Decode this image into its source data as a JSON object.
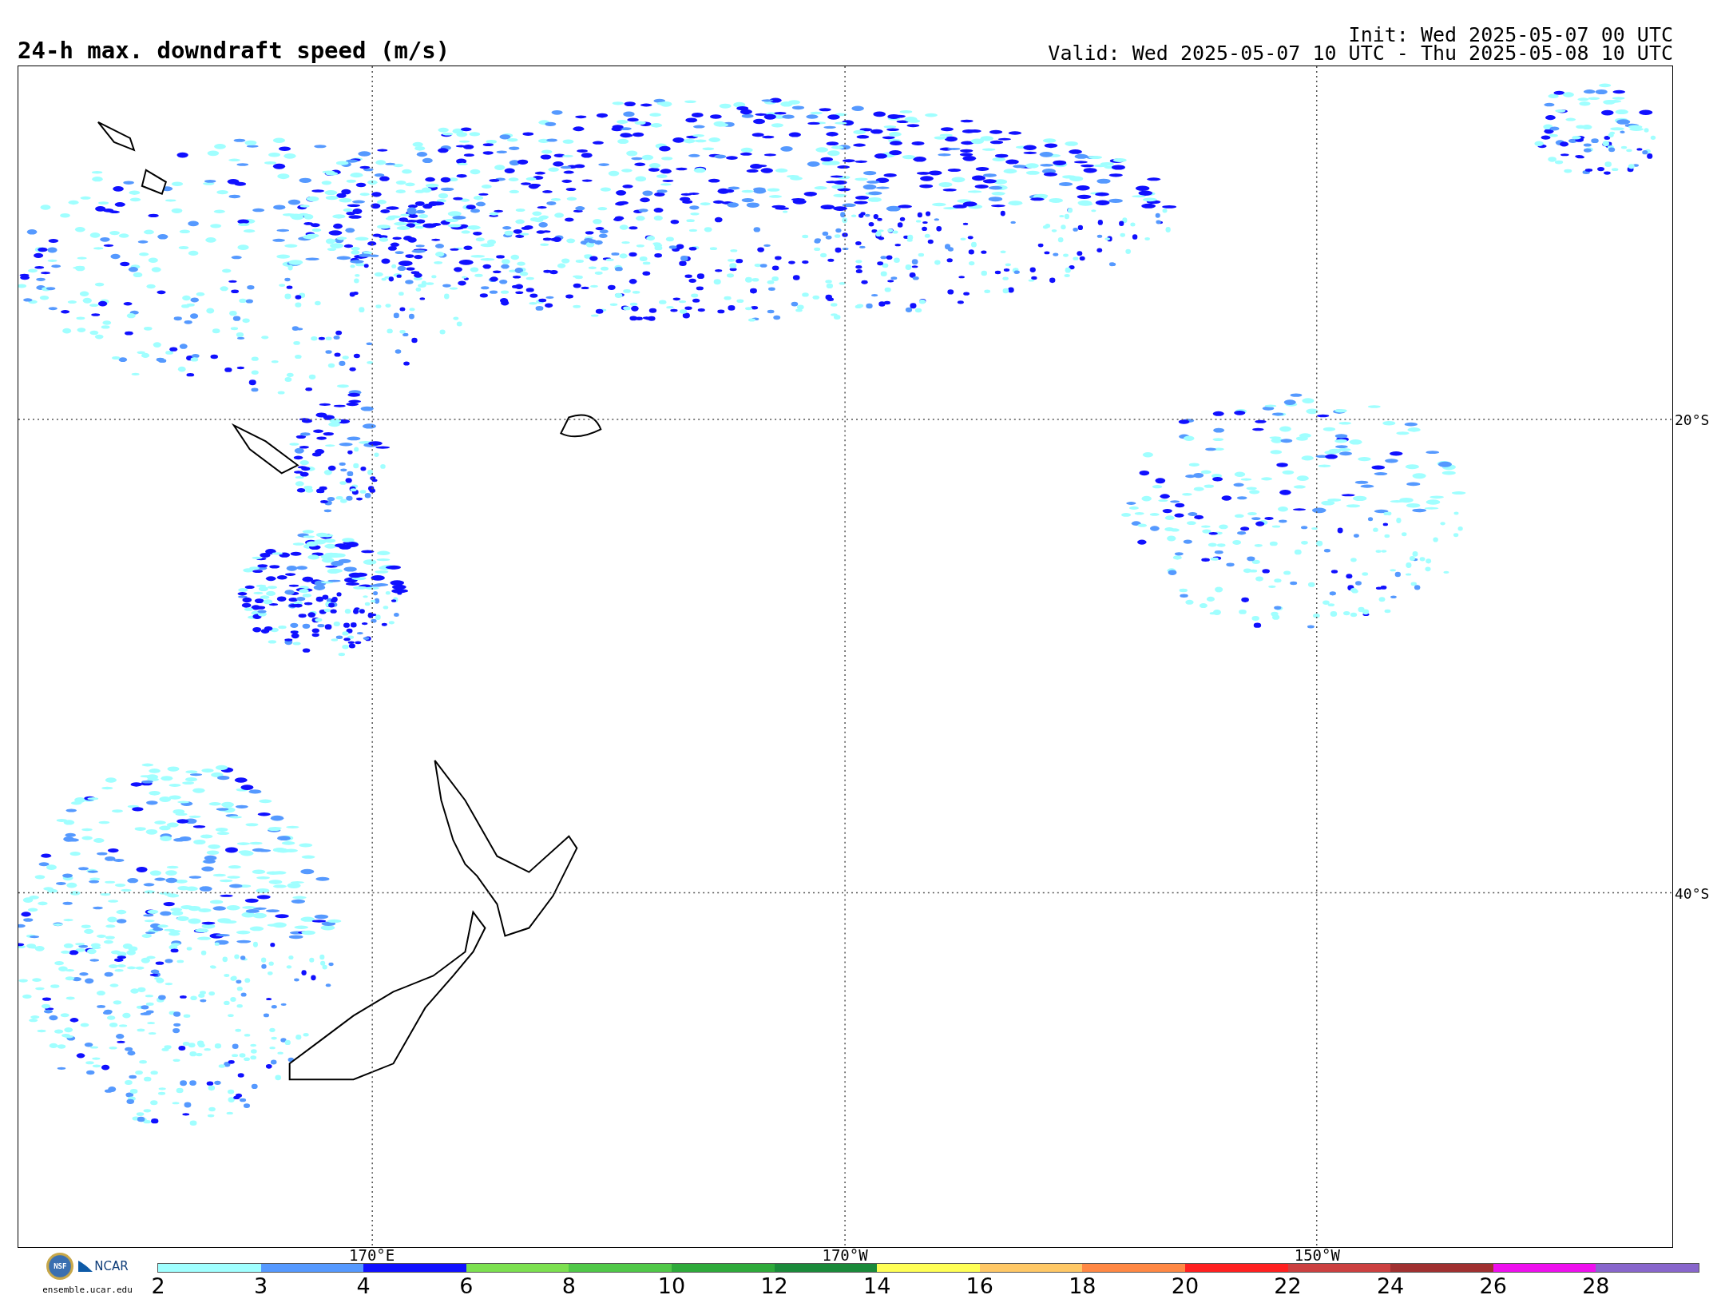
{
  "title": "24-h max. downdraft speed (m/s)",
  "init": "Init: Wed 2025-05-07 00 UTC",
  "valid": "Valid: Wed 2025-05-07 10 UTC - Thu 2025-05-08 10 UTC",
  "map": {
    "meridians": [
      {
        "label": "170°E"
      },
      {
        "label": "170°W"
      },
      {
        "label": "150°W"
      }
    ],
    "parallels": [
      {
        "label": "20°S"
      },
      {
        "label": "40°S"
      }
    ]
  },
  "logo": {
    "seal": "NSF",
    "org": "NCAR",
    "url": "ensemble.ucar.edu"
  },
  "colorbar": [
    {
      "label": "2",
      "color": "#a0ffff"
    },
    {
      "label": "3",
      "color": "#5599ff"
    },
    {
      "label": "4",
      "color": "#1010ff"
    },
    {
      "label": "6",
      "color": "#7ce050"
    },
    {
      "label": "8",
      "color": "#50c848"
    },
    {
      "label": "10",
      "color": "#2eaa3a"
    },
    {
      "label": "12",
      "color": "#1a8a3a"
    },
    {
      "label": "14",
      "color": "#ffff55"
    },
    {
      "label": "16",
      "color": "#ffc866"
    },
    {
      "label": "18",
      "color": "#ff8844"
    },
    {
      "label": "20",
      "color": "#ff2020"
    },
    {
      "label": "22",
      "color": "#cc4040"
    },
    {
      "label": "24",
      "color": "#a03030"
    },
    {
      "label": "26",
      "color": "#ee10ee"
    },
    {
      "label": "28",
      "color": "#8866cc"
    }
  ]
}
